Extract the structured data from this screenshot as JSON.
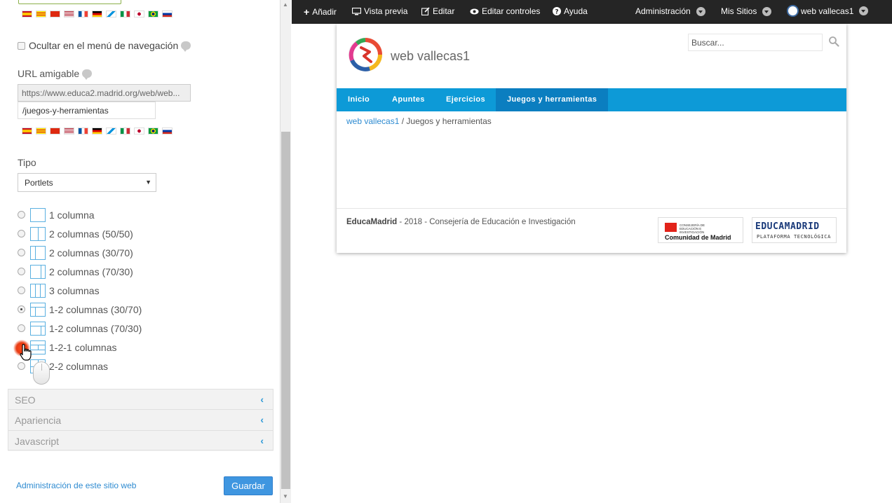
{
  "left_panel": {
    "flags": [
      "es",
      "ca",
      "zh",
      "us",
      "fr",
      "de",
      "gl",
      "it",
      "jp",
      "br",
      "ru"
    ],
    "hide_nav_label": "Ocultar en el menú de navegación",
    "friendly_url_label": "URL amigable",
    "friendly_url_prefix": "https://www.educa2.madrid.org/web/web...",
    "friendly_url_value": "/juegos-y-herramientas",
    "type_label": "Tipo",
    "type_value": "Portlets",
    "layouts": [
      {
        "label": "1 columna",
        "checked": false
      },
      {
        "label": "2 columnas (50/50)",
        "checked": false
      },
      {
        "label": "2 columnas (30/70)",
        "checked": false
      },
      {
        "label": "2 columnas (70/30)",
        "checked": false
      },
      {
        "label": "3 columnas",
        "checked": false
      },
      {
        "label": "1-2 columnas (30/70)",
        "checked": true
      },
      {
        "label": "1-2 columnas (70/30)",
        "checked": false
      },
      {
        "label": "1-2-1 columnas",
        "checked": false
      },
      {
        "label": "2-2 columnas",
        "checked": false
      }
    ],
    "sections": [
      "SEO",
      "Apariencia",
      "Javascript"
    ],
    "admin_link": "Administración de este sitio web",
    "save_label": "Guardar"
  },
  "toolbar": {
    "add": "Añadir",
    "preview": "Vista previa",
    "edit": "Editar",
    "edit_controls": "Editar controles",
    "help": "Ayuda",
    "admin": "Administración",
    "my_sites": "Mis Sitios",
    "user": "web vallecas1"
  },
  "site": {
    "title": "web vallecas1",
    "search_placeholder": "Buscar...",
    "nav": [
      "Inicio",
      "Apuntes",
      "Ejercicios",
      "Juegos y herramientas"
    ],
    "active_nav": 3,
    "breadcrumb": {
      "home": "web vallecas1",
      "separator": "/",
      "current": "Juegos y herramientas"
    },
    "footer": {
      "brand": "EducaMadrid",
      "rest": " - 2018 - Consejería de Educación e Investigación",
      "cm_small": "CONSEJERÍA DE EDUCACIÓN E INVESTIGACIÓN",
      "cm_big": "Comunidad de Madrid",
      "em_big": "EDUCAMADRID",
      "em_small": "PLATAFORMA TECNOLÓGICA"
    }
  },
  "colors": {
    "accent": "#0d9ad7",
    "nav_active": "#0b7ec0",
    "save_button": "#3f96e0",
    "toolbar_bg": "#252525"
  }
}
